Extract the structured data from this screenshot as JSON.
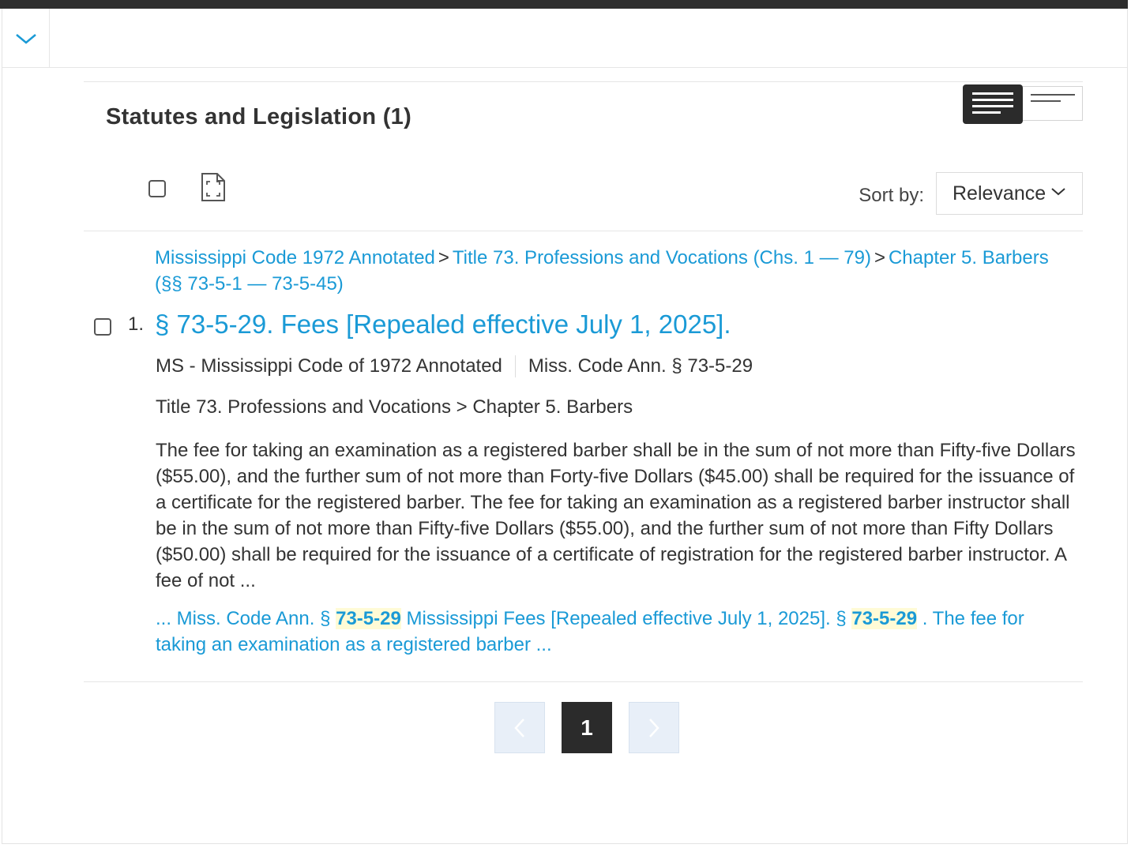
{
  "section": {
    "title": "Statutes and Legislation (1)"
  },
  "toolbar": {
    "sort_label": "Sort by:",
    "sort_value": "Relevance"
  },
  "result": {
    "breadcrumb": [
      "Mississippi Code 1972 Annotated",
      "Title 73. Professions and Vocations (Chs. 1 — 79)",
      "Chapter 5. Barbers (§§ 73-5-1 — 73-5-45)"
    ],
    "breadcrumb_separator": ">",
    "number": "1.",
    "title": "§ 73-5-29. Fees [Repealed effective July 1, 2025].",
    "source": "MS - Mississippi Code of 1972 Annotated",
    "citation": "Miss. Code Ann. § 73-5-29",
    "path": "Title 73. Professions and Vocations > Chapter 5. Barbers",
    "snippet": "The fee for taking an examination as a registered barber shall be in the sum of not more than Fifty-five Dollars ($55.00), and the further sum of not more than Forty-five Dollars ($45.00) shall be required for the issuance of a certificate for the registered barber. The fee for taking an examination as a registered barber instructor shall be in the sum of not more than Fifty-five Dollars ($55.00), and the further sum of not more than Fifty Dollars ($50.00) shall be required for the issuance of a certificate of registration for the registered barber instructor. A fee of not ...",
    "excerpt": {
      "part1": "... Miss. Code Ann. § ",
      "hl1": "73-5-29",
      "part2": " Mississippi Fees [Repealed effective July 1, 2025]. § ",
      "hl2": "73-5-29",
      "part3": " . The fee for taking an examination as a registered barber ..."
    }
  },
  "pagination": {
    "prev_icon": "chevron-left-icon",
    "current_page": "1",
    "next_icon": "chevron-right-icon"
  },
  "colors": {
    "link": "#1a9ad6",
    "dark": "#2b2b2b",
    "highlight_bg": "#fffbd6"
  }
}
